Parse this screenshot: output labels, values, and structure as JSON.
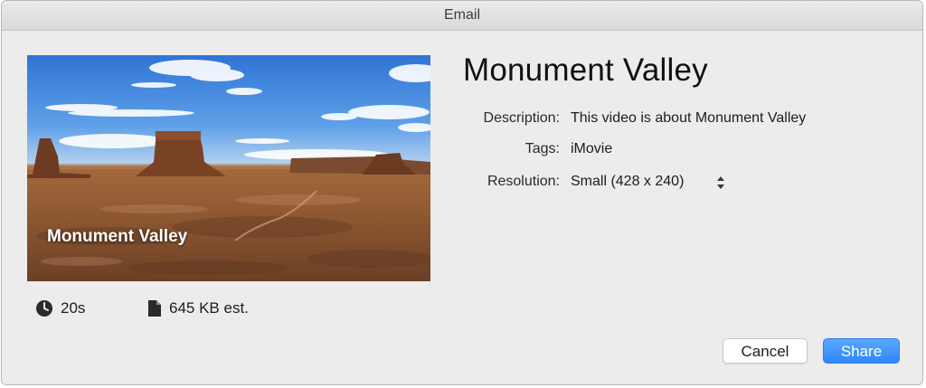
{
  "window": {
    "title": "Email"
  },
  "thumbnail": {
    "overlay_title": "Monument Valley"
  },
  "info": {
    "duration": "20s",
    "file_size": "645 KB est."
  },
  "details": {
    "title": "Monument Valley",
    "description_label": "Description:",
    "description_value": "This video is about Monument Valley",
    "tags_label": "Tags:",
    "tags_value": "iMovie",
    "resolution_label": "Resolution:",
    "resolution_value": "Small (428 x 240)"
  },
  "buttons": {
    "cancel_label": "Cancel",
    "share_label": "Share"
  },
  "colors": {
    "accent": "#2f87fb",
    "window_bg": "#ececec"
  }
}
